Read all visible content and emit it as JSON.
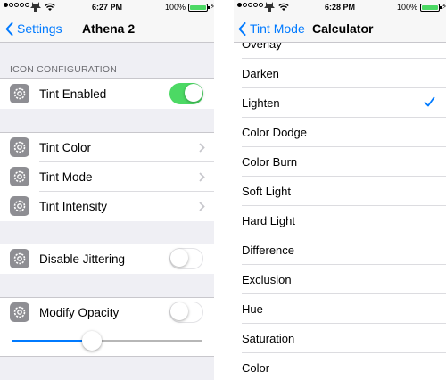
{
  "left": {
    "status": {
      "time": "6:27 PM",
      "battery": "100%",
      "signal_dots_filled": 1,
      "signal_dots_total": 5
    },
    "nav": {
      "back_label": "Settings",
      "title": "Athena 2"
    },
    "section_header": "ICON CONFIGURATION",
    "cells": {
      "tint_enabled": {
        "label": "Tint Enabled",
        "on": true
      },
      "tint_color": {
        "label": "Tint Color"
      },
      "tint_mode": {
        "label": "Tint Mode"
      },
      "tint_intensity": {
        "label": "Tint Intensity"
      },
      "disable_jittering": {
        "label": "Disable Jittering",
        "on": false
      },
      "modify_opacity": {
        "label": "Modify Opacity",
        "on": false
      }
    },
    "opacity_slider": {
      "value": 0.42
    }
  },
  "right": {
    "status": {
      "time": "6:28 PM",
      "battery": "100%",
      "signal_dots_filled": 1,
      "signal_dots_total": 5
    },
    "nav": {
      "back_label": "Tint Mode",
      "title": "Calculator"
    },
    "modes": [
      "Overlay",
      "Darken",
      "Lighten",
      "Color Dodge",
      "Color Burn",
      "Soft Light",
      "Hard Light",
      "Difference",
      "Exclusion",
      "Hue",
      "Saturation",
      "Color"
    ],
    "selected_mode": "Lighten"
  },
  "colors": {
    "accent": "#007aff",
    "toggle_on": "#4cd964",
    "group_background": "#efeff4",
    "icon_gray": "#8e8e93"
  }
}
